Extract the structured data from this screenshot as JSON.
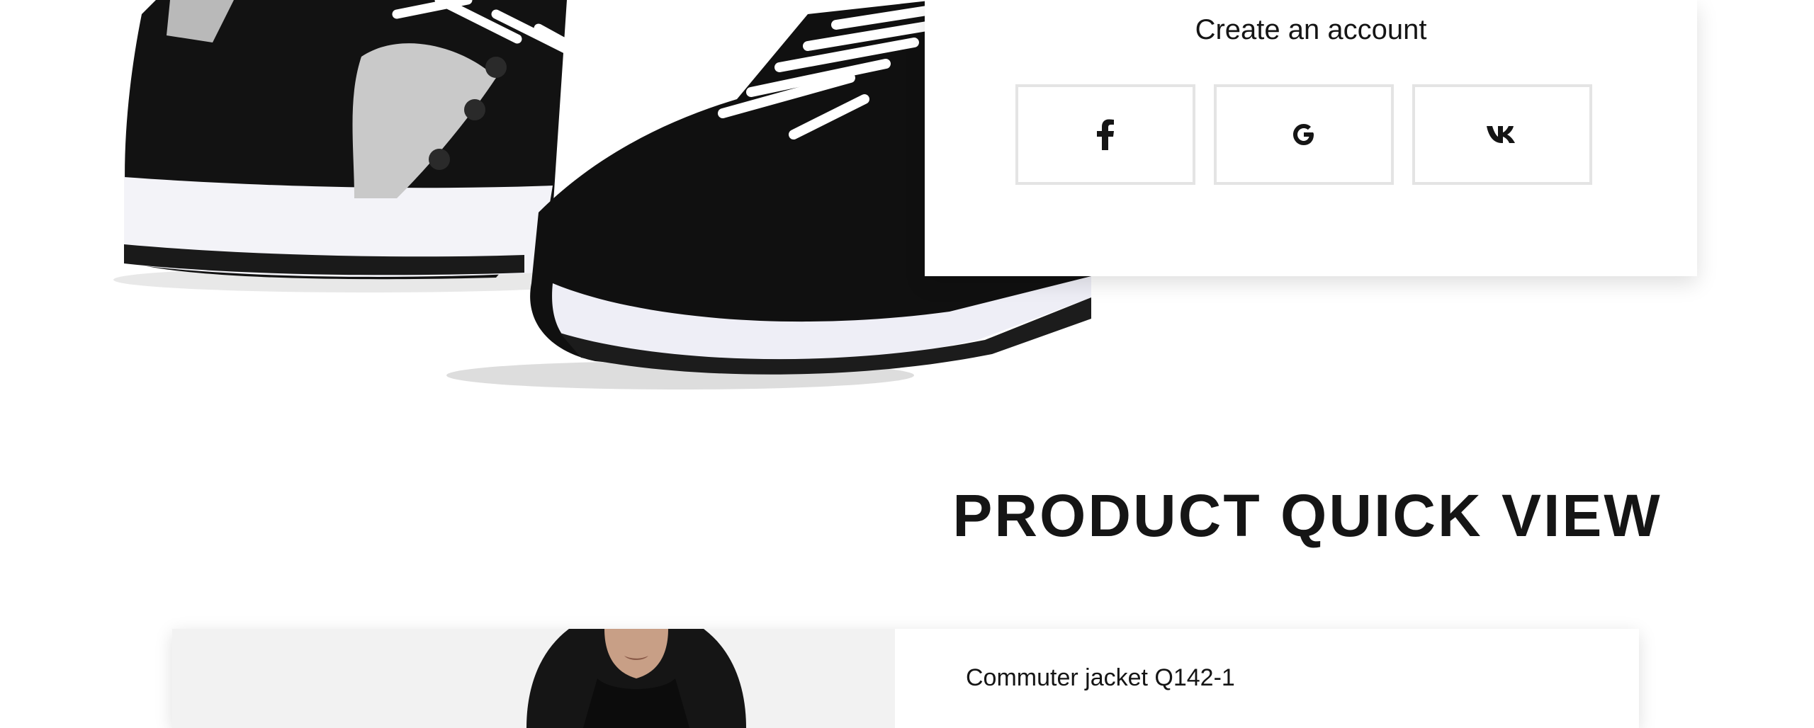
{
  "hero": {
    "image_icon": "sneaker-image"
  },
  "signup": {
    "title": "Create an account",
    "social_buttons": [
      {
        "name": "facebook",
        "icon": "facebook-icon"
      },
      {
        "name": "google",
        "icon": "google-icon"
      },
      {
        "name": "vk",
        "icon": "vk-icon"
      }
    ]
  },
  "section": {
    "title": "PRODUCT QUICK VIEW"
  },
  "quick_view": {
    "product_name": "Commuter jacket Q142-1",
    "image_icon": "jacket-model-image"
  },
  "colors": {
    "text": "#151515",
    "border": "#e4e4e4",
    "image_bg": "#f2f2f2"
  }
}
